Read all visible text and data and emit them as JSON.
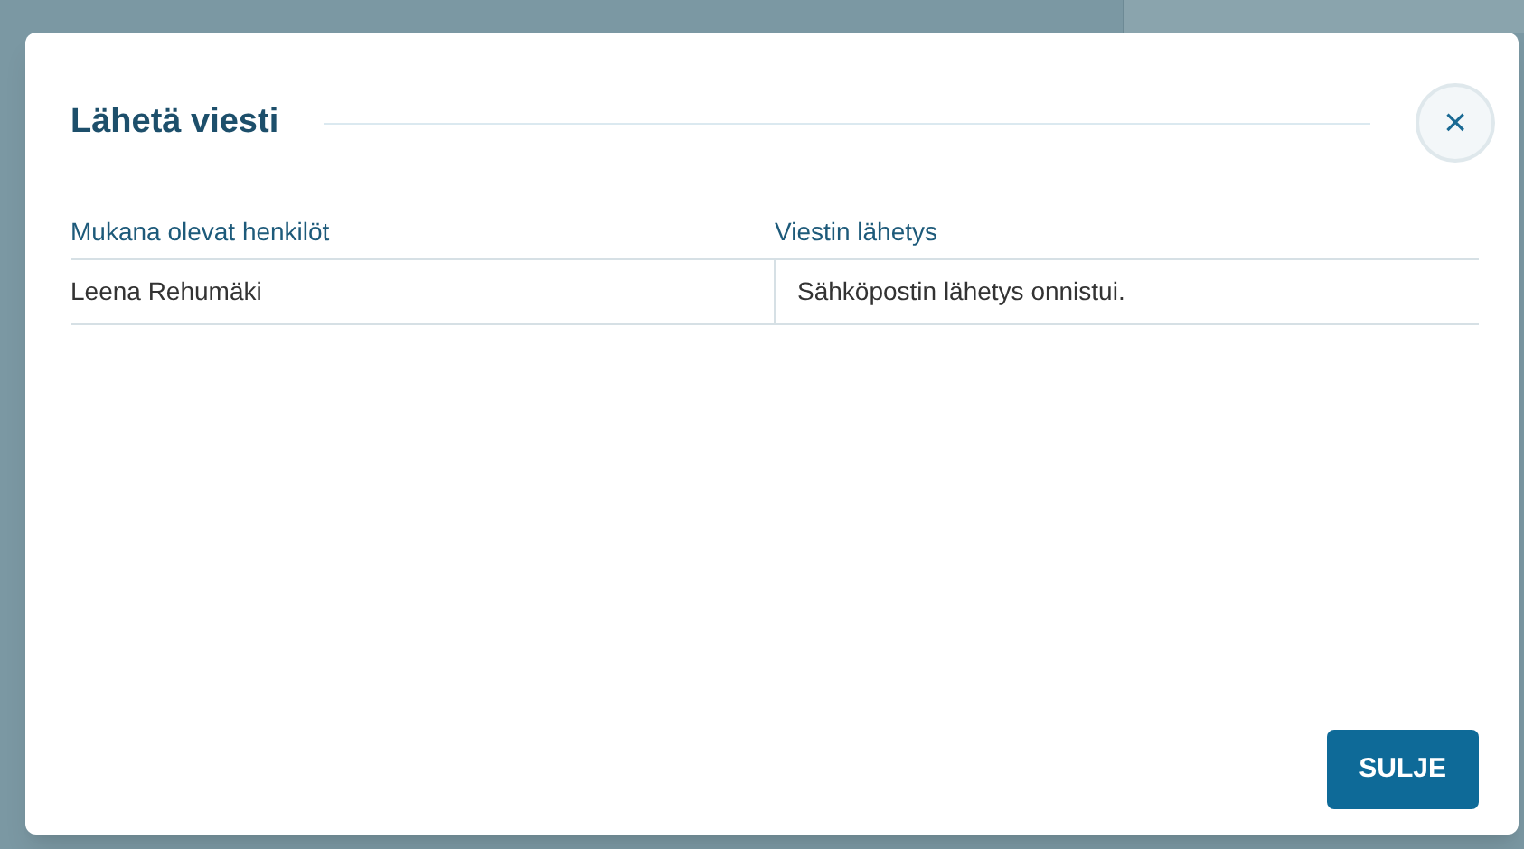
{
  "dialog": {
    "title": "Lähetä viesti",
    "close_label": "×",
    "table": {
      "columns": [
        "Mukana olevat henkilöt",
        "Viestin lähetys"
      ],
      "rows": [
        [
          "Leena Rehumäki",
          "Sähköpostin lähetys onnistui."
        ]
      ]
    },
    "buttons": [
      "SULJE"
    ]
  }
}
